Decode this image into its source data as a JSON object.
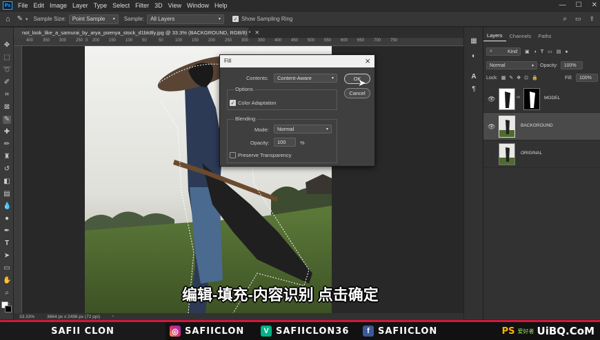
{
  "menu": [
    "File",
    "Edit",
    "Image",
    "Layer",
    "Type",
    "Select",
    "Filter",
    "3D",
    "View",
    "Window",
    "Help"
  ],
  "app_logo": "Ps",
  "window_controls": [
    "—",
    "☐",
    "✕"
  ],
  "options_bar": {
    "sample_size_label": "Sample Size:",
    "sample_size_value": "Point Sample",
    "sample_label": "Sample:",
    "sample_value": "All Layers",
    "show_ring_label": "Show Sampling Ring"
  },
  "document_tab": "not_look_like_a_samurai_by_arya_poenya_stock_d1bk8ly.jpg @ 33.3% (BACKGROUND, RGB/8) *",
  "ruler_ticks": [
    "400",
    "350",
    "300",
    "250",
    "200",
    "150",
    "100",
    "50",
    "0",
    "50",
    "100",
    "150",
    "200",
    "250",
    "300",
    "350",
    "400",
    "450",
    "500",
    "550",
    "600",
    "650",
    "700",
    "750"
  ],
  "status": {
    "zoom": "33.33%",
    "doc_info": "3664 px x 2496 px (72 ppi)"
  },
  "layers_panel": {
    "tabs": [
      "Layers",
      "Channels",
      "Paths"
    ],
    "kind_label": "Kind",
    "blend_mode": "Normal",
    "opacity_label": "Opacity:",
    "opacity_value": "100%",
    "lock_label": "Lock:",
    "fill_label": "Fill:",
    "fill_value": "100%",
    "layers": [
      {
        "name": "MODEL",
        "visible": true,
        "has_mask": true
      },
      {
        "name": "BACKGROUND",
        "visible": true,
        "selected": true
      },
      {
        "name": "ORIGINAL",
        "visible": false
      }
    ]
  },
  "fill_dialog": {
    "title": "Fill",
    "contents_label": "Contents:",
    "contents_value": "Content-Aware",
    "options_label": "Options",
    "color_adaptation_label": "Color Adaptation",
    "color_adaptation_checked": true,
    "blending_label": "Blending",
    "mode_label": "Mode:",
    "mode_value": "Normal",
    "opacity_label": "Opacity:",
    "opacity_value": "100",
    "opacity_unit": "%",
    "preserve_label": "Preserve Transparency",
    "ok_label": "OK",
    "cancel_label": "Cancel"
  },
  "subtitle": "编辑-填充-内容识别 点击确定",
  "banner": {
    "left": "SAFII CLON",
    "instagram": "SAFIICLON",
    "vine": "SAFIICLON36",
    "facebook": "SAFIICLON",
    "watermark_ps": "PS",
    "watermark_cn": "爱好者",
    "watermark_site": "UiBQ.CoM"
  },
  "colors": {
    "accent_red": "#d4183b",
    "ps_blue": "#31a8ff"
  }
}
